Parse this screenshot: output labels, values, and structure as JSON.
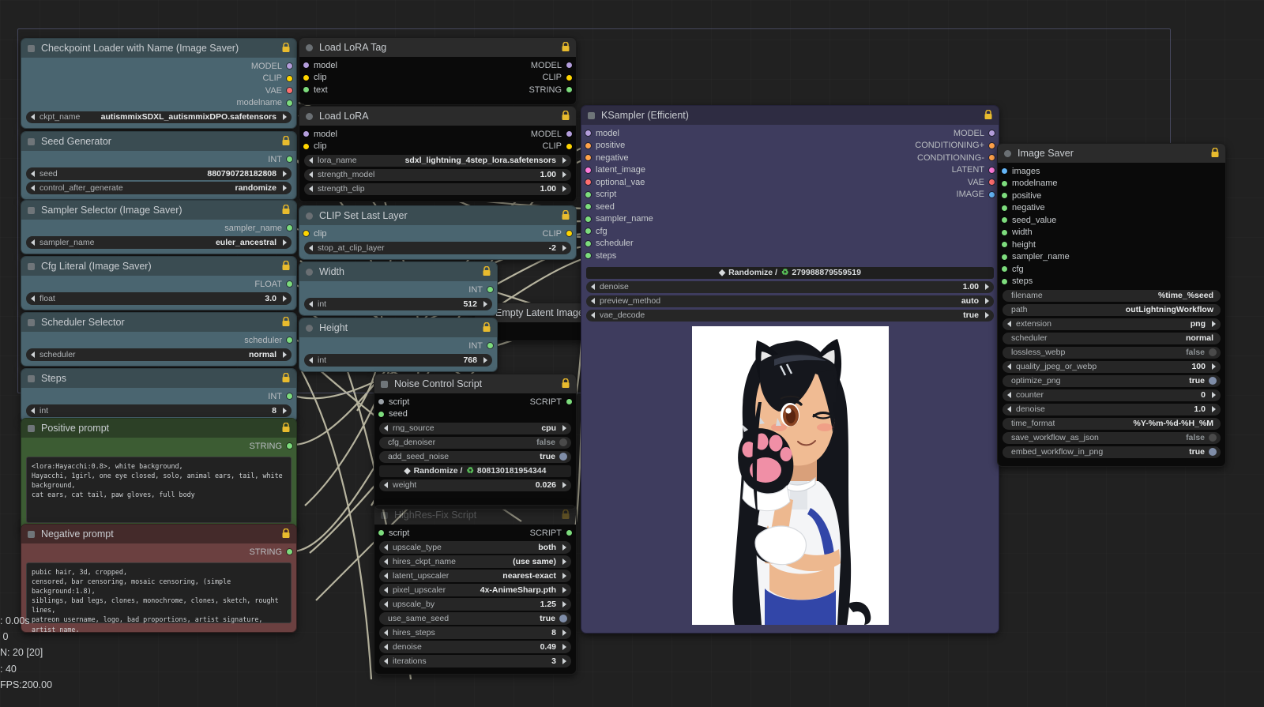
{
  "app": {
    "canvas_bg": "#212121",
    "wire_color": "#d7d3b8",
    "selection_color": "#787daf"
  },
  "status_overlay": ": 0.00s\n 0\nN: 20 [20]\n: 40\nFPS:200.00",
  "nodes": [
    {
      "id": "checkpoint_loader",
      "title": "Checkpoint Loader with Name (Image Saver)",
      "color": "teal",
      "collapse_icon": "square-collapse-icon",
      "locked": true,
      "outputs": [
        {
          "name": "MODEL",
          "color": "#b39ddb"
        },
        {
          "name": "CLIP",
          "color": "#ffd500"
        },
        {
          "name": "VAE",
          "color": "#ff6e6e"
        },
        {
          "name": "modelname",
          "color": "#7ddc7d"
        }
      ],
      "widgets": [
        {
          "label": "ckpt_name",
          "value": "autismmixSDXL_autismmixDPO.safetensors",
          "type": "combo"
        }
      ]
    },
    {
      "id": "seed_generator",
      "title": "Seed Generator",
      "color": "teal",
      "collapse_icon": "square-collapse-icon",
      "locked": true,
      "outputs": [
        {
          "name": "INT",
          "color": "#7ddc7d"
        }
      ],
      "widgets": [
        {
          "label": "seed",
          "value": "880790728182808",
          "type": "combo"
        },
        {
          "label": "control_after_generate",
          "value": "randomize",
          "type": "combo"
        }
      ]
    },
    {
      "id": "sampler_selector",
      "title": "Sampler Selector (Image Saver)",
      "color": "teal",
      "collapse_icon": "square-collapse-icon",
      "locked": true,
      "outputs": [
        {
          "name": "sampler_name",
          "color": "#7ddc7d"
        }
      ],
      "widgets": [
        {
          "label": "sampler_name",
          "value": "euler_ancestral",
          "type": "combo"
        }
      ]
    },
    {
      "id": "cfg_literal",
      "title": "Cfg Literal (Image Saver)",
      "color": "teal",
      "collapse_icon": "square-collapse-icon",
      "locked": true,
      "outputs": [
        {
          "name": "FLOAT",
          "color": "#7ddc7d"
        }
      ],
      "widgets": [
        {
          "label": "float",
          "value": "3.0",
          "type": "combo"
        }
      ]
    },
    {
      "id": "scheduler_selector",
      "title": "Scheduler Selector",
      "color": "teal",
      "collapse_icon": "square-collapse-icon",
      "locked": true,
      "outputs": [
        {
          "name": "scheduler",
          "color": "#7ddc7d"
        }
      ],
      "widgets": [
        {
          "label": "scheduler",
          "value": "normal",
          "type": "combo"
        }
      ]
    },
    {
      "id": "steps",
      "title": "Steps",
      "color": "teal",
      "collapse_icon": "square-collapse-icon",
      "locked": true,
      "outputs": [
        {
          "name": "INT",
          "color": "#7ddc7d"
        }
      ],
      "widgets": [
        {
          "label": "int",
          "value": "8",
          "type": "combo"
        }
      ]
    },
    {
      "id": "positive_prompt",
      "title": "Positive prompt",
      "color": "green",
      "collapse_icon": "square-collapse-icon",
      "locked": true,
      "outputs": [
        {
          "name": "STRING",
          "color": "#7ddc7d"
        }
      ],
      "text": "<lora:Hayacchi:0.8>, white background,\nHayacchi, 1girl, one eye closed, solo, animal ears, tail, white background,\ncat ears, cat tail, paw gloves, full body"
    },
    {
      "id": "negative_prompt",
      "title": "Negative prompt",
      "color": "red",
      "collapse_icon": "square-collapse-icon",
      "locked": true,
      "outputs": [
        {
          "name": "STRING",
          "color": "#7ddc7d"
        }
      ],
      "text": "pubic hair, 3d, cropped,\ncensored, bar censoring, mosaic censoring, (simple background:1.8),\nsiblings, bad legs, clones, monochrome, clones, sketch, rought lines,\npatreon username, logo, bad proportions, artist signature, artist name,\npubic hair"
    },
    {
      "id": "load_lora_tag",
      "title": "Load LoRA Tag",
      "color": "dark",
      "collapse_icon": "circle-collapse-icon",
      "locked": true,
      "io": [
        {
          "in": "model",
          "in_color": "#b39ddb",
          "out": "MODEL",
          "out_color": "#b39ddb"
        },
        {
          "in": "clip",
          "in_color": "#ffd500",
          "out": "CLIP",
          "out_color": "#ffd500"
        },
        {
          "in": "text",
          "in_color": "#7ddc7d",
          "out": "STRING",
          "out_color": "#7ddc7d"
        }
      ]
    },
    {
      "id": "load_lora",
      "title": "Load LoRA",
      "color": "dark",
      "collapse_icon": "circle-collapse-icon",
      "locked": true,
      "io": [
        {
          "in": "model",
          "in_color": "#b39ddb",
          "out": "MODEL",
          "out_color": "#b39ddb"
        },
        {
          "in": "clip",
          "in_color": "#ffd500",
          "out": "CLIP",
          "out_color": "#ffd500"
        }
      ],
      "widgets": [
        {
          "label": "lora_name",
          "value": "sdxl_lightning_4step_lora.safetensors",
          "type": "combo"
        },
        {
          "label": "strength_model",
          "value": "1.00",
          "type": "combo"
        },
        {
          "label": "strength_clip",
          "value": "1.00",
          "type": "combo"
        }
      ]
    },
    {
      "id": "clip_set_last_layer",
      "title": "CLIP Set Last Layer",
      "color": "teal",
      "collapse_icon": "circle-collapse-icon",
      "locked": true,
      "io": [
        {
          "in": "clip",
          "in_color": "#ffd500",
          "out": "CLIP",
          "out_color": "#ffd500"
        }
      ],
      "widgets": [
        {
          "label": "stop_at_clip_layer",
          "value": "-2",
          "type": "combo"
        }
      ]
    },
    {
      "id": "width",
      "title": "Width",
      "color": "teal",
      "collapse_icon": "circle-collapse-icon",
      "locked": true,
      "outputs": [
        {
          "name": "INT",
          "color": "#7ddc7d"
        }
      ],
      "widgets": [
        {
          "label": "int",
          "value": "512",
          "type": "combo"
        }
      ]
    },
    {
      "id": "height",
      "title": "Height",
      "color": "teal",
      "collapse_icon": "circle-collapse-icon",
      "locked": true,
      "outputs": [
        {
          "name": "INT",
          "color": "#7ddc7d"
        }
      ],
      "widgets": [
        {
          "label": "int",
          "value": "768",
          "type": "combo"
        }
      ]
    },
    {
      "id": "empty_latent_image",
      "title": "Empty Latent Image",
      "color": "dark",
      "collapse_icon": "square-collapse-icon",
      "locked": true
    },
    {
      "id": "noise_control_script",
      "title": "Noise Control Script",
      "color": "dark",
      "collapse_icon": "square-collapse-icon",
      "locked": true,
      "io": [
        {
          "in": "script",
          "in_color": "#9aa0a6",
          "out": "SCRIPT",
          "out_color": "#7ddc7d"
        },
        {
          "in": "seed",
          "in_color": "#7ddc7d",
          "out": "",
          "out_color": ""
        }
      ],
      "widgets": [
        {
          "label": "rng_source",
          "value": "cpu",
          "type": "combo"
        },
        {
          "label": "cfg_denoiser",
          "value": "false",
          "type": "toggle_off"
        },
        {
          "label": "add_seed_noise",
          "value": "true",
          "type": "toggle_on"
        },
        {
          "label": "Randomize /",
          "value": "808130181954344",
          "type": "seedbar"
        },
        {
          "label": "weight",
          "value": "0.026",
          "type": "combo"
        }
      ]
    },
    {
      "id": "hires_fix_script",
      "title": "HighRes-Fix Script",
      "color": "dark",
      "collapse_icon": "square-collapse-icon",
      "locked": true,
      "io": [
        {
          "in": "script",
          "in_color": "#7ddc7d",
          "out": "SCRIPT",
          "out_color": "#7ddc7d"
        }
      ],
      "widgets": [
        {
          "label": "upscale_type",
          "value": "both",
          "type": "combo"
        },
        {
          "label": "hires_ckpt_name",
          "value": "(use same)",
          "type": "combo"
        },
        {
          "label": "latent_upscaler",
          "value": "nearest-exact",
          "type": "combo"
        },
        {
          "label": "pixel_upscaler",
          "value": "4x-AnimeSharp.pth",
          "type": "combo"
        },
        {
          "label": "upscale_by",
          "value": "1.25",
          "type": "combo"
        },
        {
          "label": "use_same_seed",
          "value": "true",
          "type": "toggle_on"
        },
        {
          "label": "hires_steps",
          "value": "8",
          "type": "combo"
        },
        {
          "label": "denoise",
          "value": "0.49",
          "type": "combo"
        },
        {
          "label": "iterations",
          "value": "3",
          "type": "combo"
        }
      ]
    },
    {
      "id": "ksampler_efficient",
      "title": "KSampler (Efficient)",
      "color": "purple",
      "collapse_icon": "square-collapse-icon",
      "locked": true,
      "io": [
        {
          "in": "model",
          "in_color": "#b39ddb",
          "out": "MODEL",
          "out_color": "#b39ddb"
        },
        {
          "in": "positive",
          "in_color": "#ffa24a",
          "out": "CONDITIONING+",
          "out_color": "#ffa24a"
        },
        {
          "in": "negative",
          "in_color": "#ffa24a",
          "out": "CONDITIONING-",
          "out_color": "#ffa24a"
        },
        {
          "in": "latent_image",
          "in_color": "#ff7ad9",
          "out": "LATENT",
          "out_color": "#ff7ad9"
        },
        {
          "in": "optional_vae",
          "in_color": "#ff6e6e",
          "out": "VAE",
          "out_color": "#ff6e6e"
        },
        {
          "in": "script",
          "in_color": "#7ddc7d",
          "out": "IMAGE",
          "out_color": "#64b5f6"
        },
        {
          "in": "seed",
          "in_color": "#7ddc7d",
          "out": "",
          "out_color": ""
        },
        {
          "in": "sampler_name",
          "in_color": "#7ddc7d",
          "out": "",
          "out_color": ""
        },
        {
          "in": "cfg",
          "in_color": "#7ddc7d",
          "out": "",
          "out_color": ""
        },
        {
          "in": "scheduler",
          "in_color": "#7ddc7d",
          "out": "",
          "out_color": ""
        },
        {
          "in": "steps",
          "in_color": "#7ddc7d",
          "out": "",
          "out_color": ""
        }
      ],
      "widgets": [
        {
          "label": "Randomize /",
          "value": "279988879559519",
          "type": "seedbar"
        },
        {
          "label": "denoise",
          "value": "1.00",
          "type": "combo"
        },
        {
          "label": "preview_method",
          "value": "auto",
          "type": "combo"
        },
        {
          "label": "vae_decode",
          "value": "true",
          "type": "combo"
        }
      ],
      "preview": {
        "alt": "anime girl with cat ears and paw gloves, one eye closed, white background"
      }
    },
    {
      "id": "image_saver",
      "title": "Image Saver",
      "color": "dark",
      "collapse_icon": "circle-collapse-icon",
      "locked": true,
      "inputs": [
        {
          "name": "images",
          "color": "#64b5f6"
        },
        {
          "name": "modelname",
          "color": "#7ddc7d"
        },
        {
          "name": "positive",
          "color": "#7ddc7d"
        },
        {
          "name": "negative",
          "color": "#7ddc7d"
        },
        {
          "name": "seed_value",
          "color": "#7ddc7d"
        },
        {
          "name": "width",
          "color": "#7ddc7d"
        },
        {
          "name": "height",
          "color": "#7ddc7d"
        },
        {
          "name": "sampler_name",
          "color": "#7ddc7d"
        },
        {
          "name": "cfg",
          "color": "#7ddc7d"
        },
        {
          "name": "steps",
          "color": "#7ddc7d"
        }
      ],
      "widgets": [
        {
          "label": "filename",
          "value": "%time_%seed",
          "type": "text"
        },
        {
          "label": "path",
          "value": "outLightningWorkflow",
          "type": "text"
        },
        {
          "label": "extension",
          "value": "png",
          "type": "combo"
        },
        {
          "label": "scheduler",
          "value": "normal",
          "type": "text"
        },
        {
          "label": "lossless_webp",
          "value": "false",
          "type": "toggle_off"
        },
        {
          "label": "quality_jpeg_or_webp",
          "value": "100",
          "type": "combo"
        },
        {
          "label": "optimize_png",
          "value": "true",
          "type": "toggle_on"
        },
        {
          "label": "counter",
          "value": "0",
          "type": "combo"
        },
        {
          "label": "denoise",
          "value": "1.0",
          "type": "combo"
        },
        {
          "label": "time_format",
          "value": "%Y-%m-%d-%H_%M",
          "type": "text"
        },
        {
          "label": "save_workflow_as_json",
          "value": "false",
          "type": "toggle_off"
        },
        {
          "label": "embed_workflow_in_png",
          "value": "true",
          "type": "toggle_on"
        }
      ]
    }
  ]
}
